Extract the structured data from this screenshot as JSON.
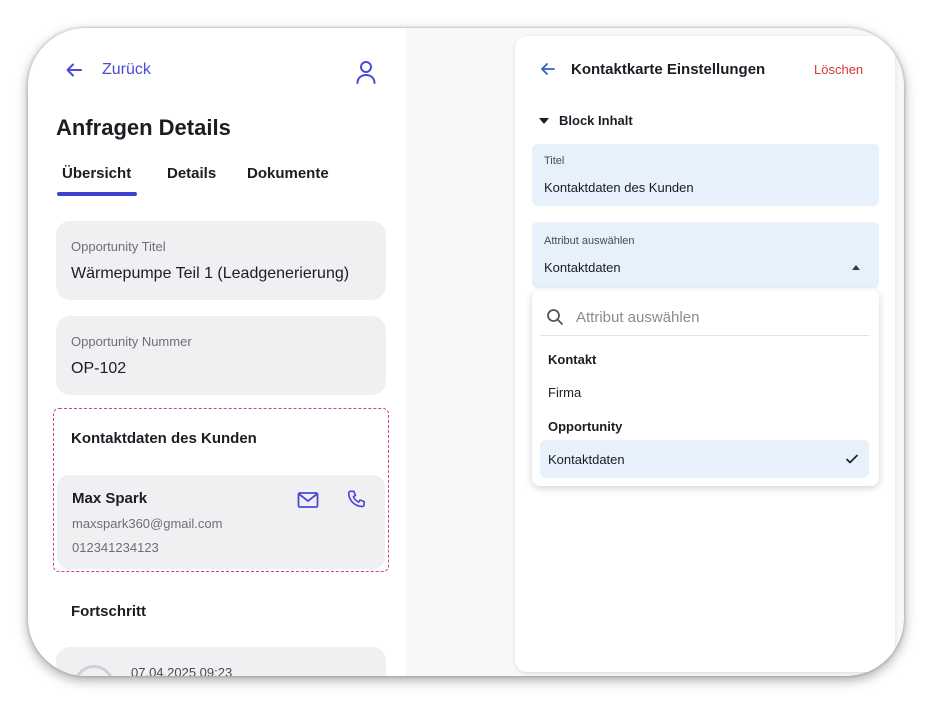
{
  "left_panel": {
    "back_label": "Zurück",
    "page_title": "Anfragen Details",
    "tabs": [
      {
        "label": "Übersicht",
        "active": true
      },
      {
        "label": "Details",
        "active": false
      },
      {
        "label": "Dokumente",
        "active": false
      }
    ],
    "opportunity_title": {
      "label": "Opportunity Titel",
      "value": "Wärmepumpe Teil 1 (Leadgenerierung)"
    },
    "opportunity_number": {
      "label": "Opportunity Nummer",
      "value": "OP-102"
    },
    "contact_block": {
      "title": "Kontaktdaten des Kunden",
      "name": "Max Spark",
      "email": "maxspark360@gmail.com",
      "phone": "012341234123"
    },
    "progress": {
      "title": "Fortschritt",
      "date": "07.04.2025 09:23"
    }
  },
  "right_panel": {
    "title": "Kontaktkarte Einstellungen",
    "delete_label": "Löschen",
    "block_section": "Block Inhalt",
    "title_field": {
      "label": "Titel",
      "value": "Kontaktdaten des Kunden"
    },
    "attribute_field": {
      "label": "Attribut auswählen",
      "value": "Kontaktdaten"
    },
    "dropdown": {
      "search_placeholder": "Attribut auswählen",
      "groups": [
        {
          "label": "Kontakt",
          "options": [
            {
              "label": "Firma",
              "selected": false
            }
          ]
        },
        {
          "label": "Opportunity",
          "options": [
            {
              "label": "Kontaktdaten",
              "selected": true
            }
          ]
        }
      ]
    }
  },
  "colors": {
    "accent": "#4040d0",
    "danger": "#d53535",
    "field_bg": "#e6f1fb",
    "card_bg": "#f0f0f2",
    "dashed_border": "#d33ba6"
  }
}
